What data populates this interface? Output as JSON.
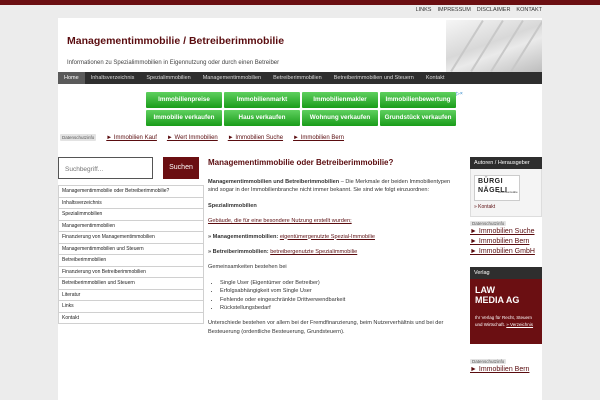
{
  "top_links": [
    "LINKS",
    "IMPRESSUM",
    "DISCLAIMER",
    "KONTAKT"
  ],
  "site": {
    "title": "Managementimmobilie / Betreiberimmobilie",
    "description": "Informationen zu Spezialimmobilien in Eigennutzung oder durch einen Betreiber"
  },
  "nav": [
    "Home",
    "Inhaltsverzeichnis",
    "Spezialimmobilien",
    "Managementimmobilien",
    "Betreiberimmobilien",
    "Betreiberimmobilien und Steuern",
    "Kontakt"
  ],
  "ads": [
    "Immobilienpreise",
    "Immobilienmarkt",
    "Immobilienmakler",
    "Immobilienbewertung",
    "Immobilie verkaufen",
    "Haus verkaufen",
    "Wohnung verkaufen",
    "Grundstück verkaufen"
  ],
  "adchoice": "▷×",
  "datenschutz_label": "Datenschutzinfo",
  "link_unit": [
    "► Immobilien Kauf",
    "► Wert Immobilien",
    "► Immobilien Suche",
    "► Immobilien Bern"
  ],
  "search": {
    "placeholder": "Suchbegriff...",
    "button": "Suchen"
  },
  "sidenav": [
    "Managementimmobilie oder Betreiberimmobilie?",
    "Inhaltsverzeichnis",
    "Spezialimmobilien",
    "Managementimmobilien",
    "Finanzierung von Managementimmobilien",
    "Managementimmobilien und Steuern",
    "Betreiberimmobilien",
    "Finanzierung von Betreiberimmobilien",
    "Betreiberimmobilien und Steuern",
    "Literatur",
    "Links",
    "Kontakt"
  ],
  "main": {
    "heading": "Managementimmobilie oder Betreiberimmobilie?",
    "intro_bold": "Managementimmobilien und Betreiberimmobilien",
    "intro_rest": " – Die Merkmale der beiden Immobilientypen sind sogar in der Immobilienbranche nicht immer bekannt. Sie sind wie folgt einzuordnen:",
    "sub_heading": "Spezialimmobilien",
    "sub_link": "Gebäude, die für eine besondere Nutzung erstellt wurden;",
    "item1_label": "» Managementimmobilien:",
    "item1_link": "eigentümergenutzte Spezial-Immobilie",
    "item2_label": "» Betreiberimmobilien:",
    "item2_link": "betreibergenutzte Spezialimmobilie",
    "common_heading": "Gemeinsamkeiten bestehen bei",
    "common_items": [
      "Single User (Eigentümer oder Betreiber)",
      "Erfolgsabhängigkeit vom Single User",
      "Fehlende oder eingeschränkte Drittverwendbarkeit",
      "Rückstellungsbedarf"
    ],
    "closing": "Unterschiede bestehen vor allem bei der Fremdfinanzierung, beim Nutzerverhältnis und bei der Besteuerung (ordentliche Besteuerung, Grundsteuern)."
  },
  "right": {
    "authors_title": "Autoren / Herausgeber",
    "logo_line1": "BÜRGI",
    "logo_line2": "NÄGELI",
    "logo_sub": "Rechtsanwälte",
    "kontakt_link": "» Kontakt",
    "links1": [
      "► Immobilien Suche",
      "► Immobilien Bern",
      "► Immobilien GmbH"
    ],
    "verlag_title": "Verlag",
    "verlag_name_1": "LAW",
    "verlag_name_2": "MEDIA AG",
    "verlag_desc": "Ihr Verlag für Recht, Steuern und Wirtschaft.",
    "verlag_link": "» Verzeichnis",
    "links2": [
      "► Immobilien Bern"
    ]
  }
}
